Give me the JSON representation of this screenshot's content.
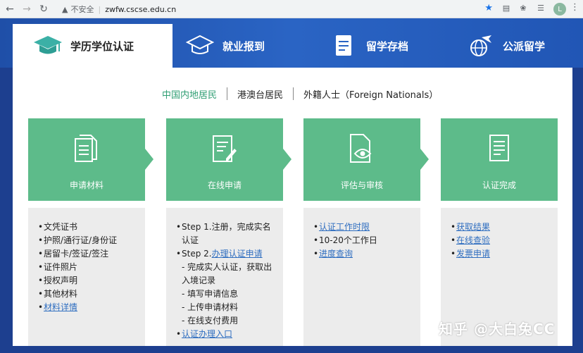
{
  "browser": {
    "security_label": "不安全",
    "url": "zwfw.cscse.edu.cn",
    "avatar_letter": "L"
  },
  "tabs": [
    {
      "label": "学历学位认证",
      "icon": "graduation-cap-icon",
      "active": true
    },
    {
      "label": "就业报到",
      "icon": "cap-outline-icon",
      "active": false
    },
    {
      "label": "留学存档",
      "icon": "archive-document-icon",
      "active": false
    },
    {
      "label": "公派留学",
      "icon": "globe-plane-icon",
      "active": false
    }
  ],
  "subtabs": [
    {
      "label": "中国内地居民",
      "active": true
    },
    {
      "label": "港澳台居民",
      "active": false
    },
    {
      "label": "外籍人士（Foreign Nationals）",
      "active": false
    }
  ],
  "steps": [
    {
      "label": "申请材料",
      "icon": "documents-icon"
    },
    {
      "label": "在线申请",
      "icon": "edit-form-icon"
    },
    {
      "label": "评估与审核",
      "icon": "review-eye-icon"
    },
    {
      "label": "认证完成",
      "icon": "certificate-icon"
    }
  ],
  "details": {
    "col1": [
      "文凭证书",
      "护照/通行证/身份证",
      "居留卡/签证/签注",
      "证件照片",
      "授权声明",
      "其他材料",
      "材料详情"
    ],
    "col2": {
      "step1": "Step 1.注册，完成实名认证",
      "step2_prefix": "Step 2.",
      "step2_link": "办理认证申请",
      "sub1": "- 完成实人认证，获取出入境记录",
      "sub2": "- 填写申请信息",
      "sub3": "- 上传申请材料",
      "sub4": "- 在线支付费用",
      "entry_link": "认证办理入口"
    },
    "col3": [
      "认证工作时限",
      "10-20个工作日",
      "进度查询"
    ],
    "col4": [
      "获取结果",
      "在线查验",
      "发票申请"
    ]
  },
  "watermark": "知乎 @大白兔CC",
  "colors": {
    "accent_green": "#5dbb8a",
    "link_blue": "#2f6ec0",
    "band_blue": "#2a64c4"
  }
}
